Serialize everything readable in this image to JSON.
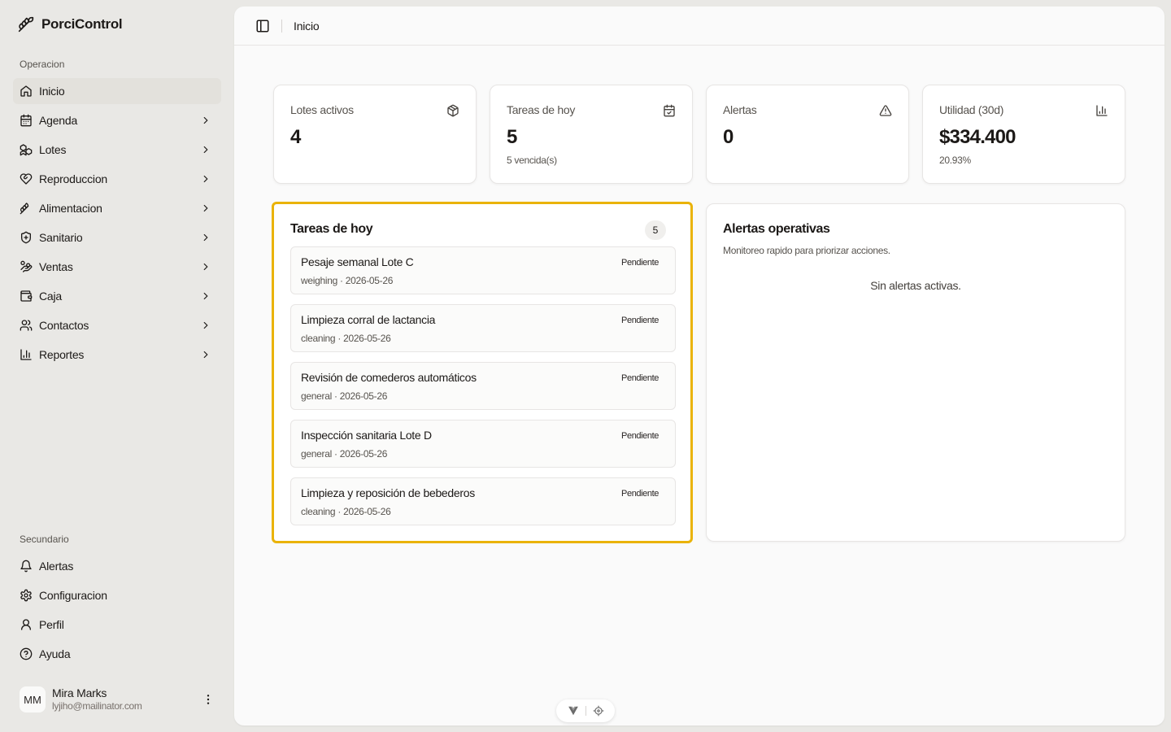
{
  "brand": {
    "name": "PorciControl",
    "icon": "pig-icon"
  },
  "sidebar": {
    "primary_label": "Operacion",
    "items": [
      {
        "label": "Inicio",
        "icon": "home-icon",
        "active": true,
        "chevron": false
      },
      {
        "label": "Agenda",
        "icon": "calendar-icon",
        "chevron": true
      },
      {
        "label": "Lotes",
        "icon": "boxes-icon",
        "chevron": true
      },
      {
        "label": "Reproduccion",
        "icon": "heart-handshake-icon",
        "chevron": true
      },
      {
        "label": "Alimentacion",
        "icon": "wheat-icon",
        "chevron": true
      },
      {
        "label": "Sanitario",
        "icon": "shield-plus-icon",
        "chevron": true
      },
      {
        "label": "Ventas",
        "icon": "hand-coins-icon",
        "chevron": true
      },
      {
        "label": "Caja",
        "icon": "wallet-icon",
        "chevron": true
      },
      {
        "label": "Contactos",
        "icon": "users-icon",
        "chevron": true
      },
      {
        "label": "Reportes",
        "icon": "bar-chart-icon",
        "chevron": true
      }
    ],
    "secondary_label": "Secundario",
    "secondary_items": [
      {
        "label": "Alertas",
        "icon": "bell-icon"
      },
      {
        "label": "Configuracion",
        "icon": "settings-icon"
      },
      {
        "label": "Perfil",
        "icon": "user-icon"
      },
      {
        "label": "Ayuda",
        "icon": "help-circle-icon"
      }
    ],
    "user": {
      "initials": "MM",
      "name": "Mira Marks",
      "email": "lyjiho@mailinator.com"
    }
  },
  "header": {
    "breadcrumb": "Inicio"
  },
  "stats": [
    {
      "label": "Lotes activos",
      "value": "4",
      "sub": "",
      "icon": "package-icon"
    },
    {
      "label": "Tareas de hoy",
      "value": "5",
      "sub": "5 vencida(s)",
      "icon": "calendar-check-icon"
    },
    {
      "label": "Alertas",
      "value": "0",
      "sub": "",
      "icon": "alert-triangle-icon"
    },
    {
      "label": "Utilidad (30d)",
      "value": "$334.400",
      "sub": "20.93%",
      "icon": "bar-chart-icon"
    }
  ],
  "tasks_card": {
    "title": "Tareas de hoy",
    "count": "5",
    "items": [
      {
        "title": "Pesaje semanal Lote C",
        "meta": "weighing · 2026-05-26",
        "status": "Pendiente"
      },
      {
        "title": "Limpieza corral de lactancia",
        "meta": "cleaning · 2026-05-26",
        "status": "Pendiente"
      },
      {
        "title": "Revisión de comederos automáticos",
        "meta": "general · 2026-05-26",
        "status": "Pendiente"
      },
      {
        "title": "Inspección sanitaria Lote D",
        "meta": "general · 2026-05-26",
        "status": "Pendiente"
      },
      {
        "title": "Limpieza y reposición de bebederos",
        "meta": "cleaning · 2026-05-26",
        "status": "Pendiente"
      }
    ]
  },
  "alerts_card": {
    "title": "Alertas operativas",
    "subtitle": "Monitoreo rapido para priorizar acciones.",
    "empty": "Sin alertas activas."
  },
  "colors": {
    "highlight": "#eab308",
    "sidebar_bg": "#e9e8e5",
    "panel_bg": "#fafafa"
  }
}
